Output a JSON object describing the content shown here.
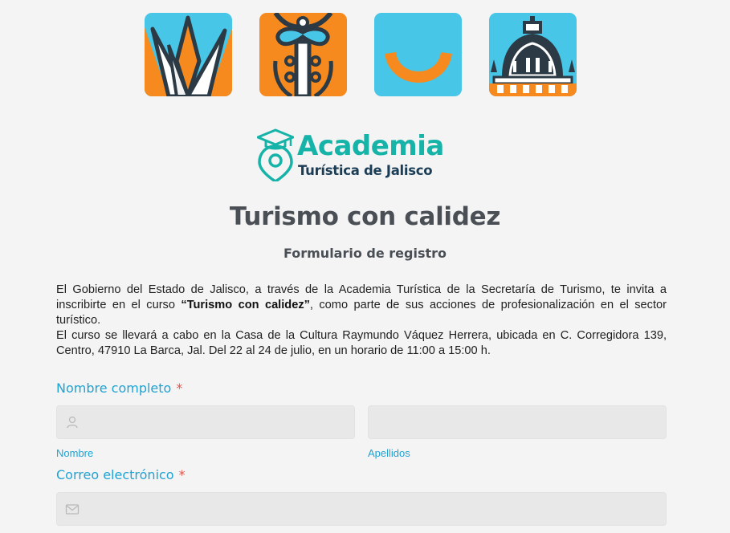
{
  "tiles": [
    {
      "icon": "agave-plant-icon",
      "bg": "#47c6e8",
      "accent": "#f68a1f"
    },
    {
      "icon": "charro-suit-icon",
      "bg": "#f68a1f",
      "accent": "#47c6e8"
    },
    {
      "icon": "smile-icon",
      "bg": "#47c6e8",
      "accent": "#f68a1f"
    },
    {
      "icon": "cathedral-dome-icon",
      "bg": "#47c6e8",
      "accent": "#f68a1f"
    }
  ],
  "logo": {
    "line1": "Academia",
    "line2": "Turística de Jalisco",
    "icon": "graduation-cap-pin-icon"
  },
  "header": {
    "title": "Turismo con calidez",
    "subtitle": "Formulario de registro"
  },
  "intro": {
    "p1_start": "El Gobierno del Estado de Jalisco, a través de la Academia Turística de la Secretaría de Turismo, te invita a inscribirte en el curso ",
    "p1_bold": "“Turismo con calidez”",
    "p1_end": ", como parte de sus acciones de profesionalización en el sector turístico.",
    "p2": "El curso se llevará a cabo en la Casa de la Cultura Raymundo Váquez Herrera, ubicada en C. Corregidora 139, Centro, 47910 La Barca, Jal. Del 22 al 24 de julio, en un horario de 11:00 a 15:00 h."
  },
  "form": {
    "name": {
      "label": "Nombre completo",
      "required_mark": "*",
      "first": {
        "value": "",
        "sublabel": "Nombre",
        "icon": "user-icon"
      },
      "last": {
        "value": "",
        "sublabel": "Apellidos"
      }
    },
    "email": {
      "label": "Correo electrónico",
      "required_mark": "*",
      "value": "",
      "icon": "envelope-icon"
    }
  },
  "colors": {
    "accent_blue": "#1fa3d4",
    "required_red": "#e5534b",
    "brand_teal": "#16b3a8",
    "brand_navy": "#1c3d56"
  }
}
